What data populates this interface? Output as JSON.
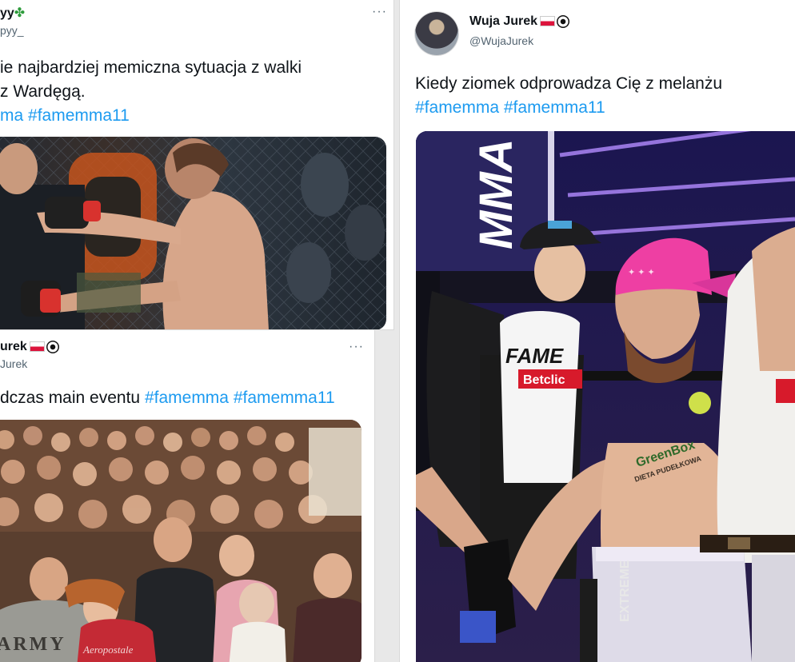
{
  "tweet_left_top": {
    "name_suffix": "yy",
    "handle_suffix": "pyy_",
    "text_line1": "ie najbardziej memiczna sytuacja z walki",
    "text_line2": "z Wardęgą.",
    "hashtag_partial": "ma",
    "hashtag_2": "#famemma11",
    "more_label": "···"
  },
  "tweet_left_bottom": {
    "name_suffix": "urek",
    "handle_suffix": "Jurek",
    "text_prefix": "dczas main eventu",
    "hashtag_1": "#famemma",
    "hashtag_2": "#famemma11",
    "more_label": "···",
    "shirt_text_1": "ARMY",
    "shirt_text_2": "Aeropostale"
  },
  "tweet_right": {
    "name": "Wuja Jurek",
    "handle": "@WujaJurek",
    "text": "Kiedy ziomek odprowadza Cię z melanżu",
    "hashtag_1": "#famemma",
    "hashtag_2": "#famemma11",
    "banner_text": "MMA",
    "shirt_brand": "FAME",
    "shirt_sponsor": "Betclic",
    "body_tattoo": "GreenBox",
    "body_tattoo_2": "DIETA PUDEŁKOWA",
    "shorts_text": "EXTREME"
  },
  "colors": {
    "hashtag": "#1d9bf0",
    "text": "#0f1419",
    "muted": "#536471"
  }
}
